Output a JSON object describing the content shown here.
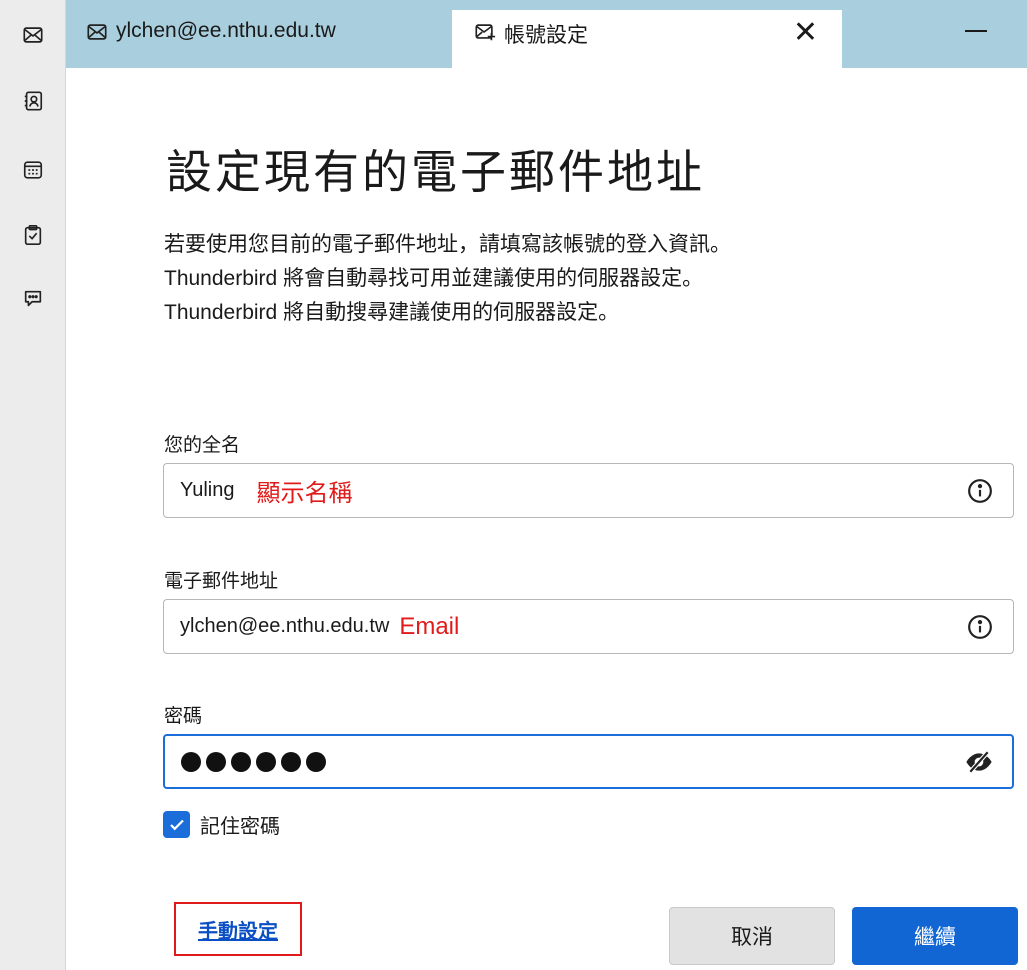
{
  "tabs": [
    {
      "label": "ylchen@ee.nthu.edu.tw",
      "icon": "mail-icon"
    },
    {
      "label": "帳號設定",
      "icon": "account-setup-icon",
      "active": true
    }
  ],
  "tab_close_symbol": "✕",
  "spaces": [
    "mail-icon",
    "address-book-icon",
    "calendar-icon",
    "tasks-icon",
    "chat-icon"
  ],
  "page": {
    "title": "設定現有的電子郵件地址",
    "description": [
      "若要使用您目前的電子郵件地址，請填寫該帳號的登入資訊。",
      "Thunderbird 將會自動尋找可用並建議使用的伺服器設定。",
      "Thunderbird 將自動搜尋建議使用的伺服器設定。"
    ]
  },
  "form": {
    "name": {
      "label": "您的全名",
      "value": "Yuling",
      "annotation": "顯示名稱"
    },
    "email": {
      "label": "電子郵件地址",
      "value": "ylchen@ee.nthu.edu.tw",
      "annotation": "Email"
    },
    "password": {
      "label": "密碼",
      "masked_length": 6
    },
    "remember": {
      "label": "記住密碼",
      "checked": true
    }
  },
  "actions": {
    "manual": "手動設定",
    "cancel": "取消",
    "continue": "繼續"
  },
  "colors": {
    "tabbar": "#a9cedd",
    "accent": "#1266d4",
    "annotation": "#e11a1a"
  }
}
